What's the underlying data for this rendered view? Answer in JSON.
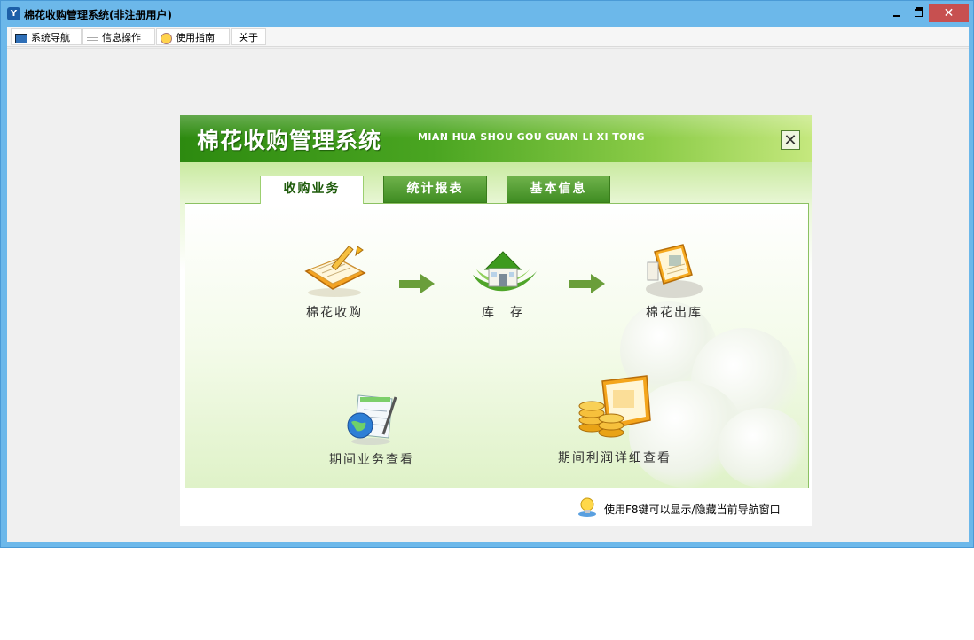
{
  "window": {
    "title": "棉花收购管理系统(非注册用户)",
    "close_glyph": "✕"
  },
  "menubar": {
    "items": [
      {
        "label": "系统导航",
        "icon": "monitor-icon"
      },
      {
        "label": "信息操作",
        "icon": "grid-icon"
      },
      {
        "label": "使用指南",
        "icon": "smiley-icon"
      },
      {
        "label": "关于",
        "icon": ""
      }
    ]
  },
  "panel": {
    "title": "棉花收购管理系统",
    "subtitle": "MIAN HUA SHOU GOU GUAN LI XI TONG",
    "close_glyph": "✕",
    "tabs": [
      {
        "label": "收购业务",
        "active": true
      },
      {
        "label": "统计报表",
        "active": false
      },
      {
        "label": "基本信息",
        "active": false
      }
    ],
    "items": [
      {
        "label": "棉花收购",
        "icon": "purchase-notebook-icon"
      },
      {
        "label": "库　存",
        "icon": "house-leaf-icon"
      },
      {
        "label": "棉花出库",
        "icon": "outbound-document-icon"
      },
      {
        "label": "期间业务查看",
        "icon": "globe-document-icon"
      },
      {
        "label": "期间利润详细查看",
        "icon": "coins-screen-icon"
      }
    ],
    "hint": "使用F8键可以显示/隐藏当前导航窗口",
    "colors": {
      "accent_green": "#4aa521",
      "tab_text": "#1d5a0a"
    }
  }
}
